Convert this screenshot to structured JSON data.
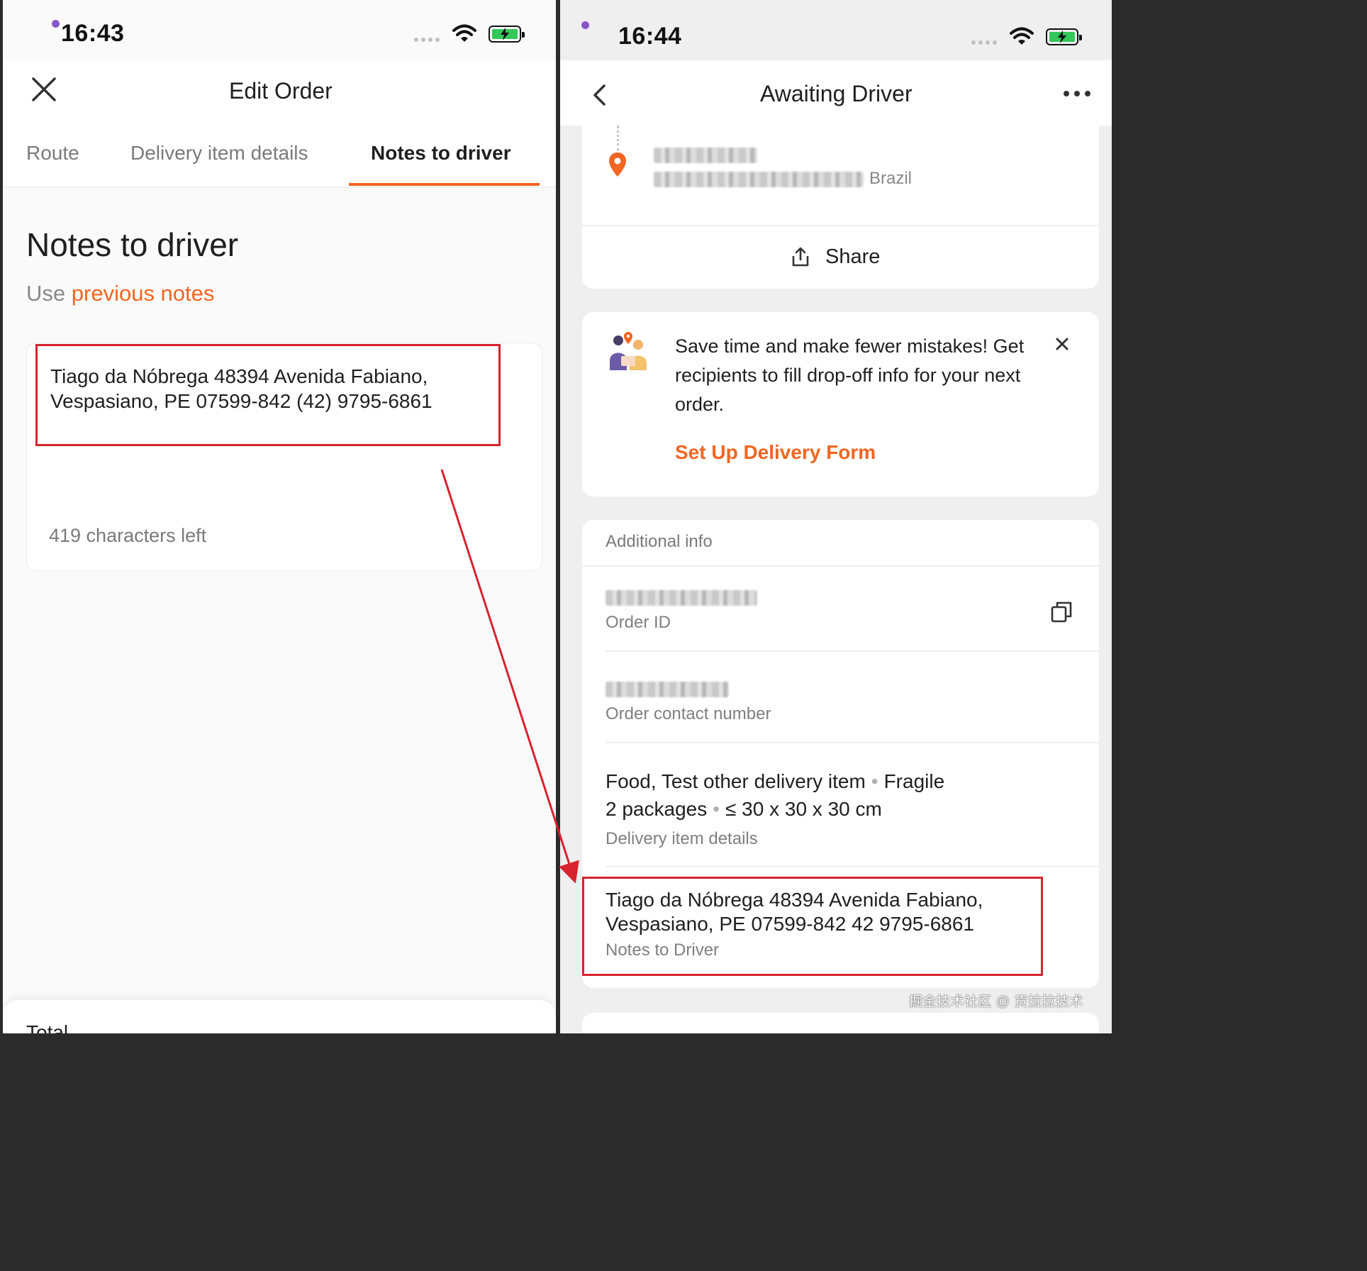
{
  "left": {
    "status": {
      "time": "16:43"
    },
    "header": {
      "title": "Edit Order"
    },
    "tabs": [
      {
        "label": "Route"
      },
      {
        "label": "Delivery item details"
      },
      {
        "label": "Notes to driver",
        "active": true
      }
    ],
    "section_title": "Notes to driver",
    "use_prefix": "Use",
    "use_link": "previous notes",
    "notes": {
      "text": "Tiago da Nóbrega  48394 Avenida Fabiano, Vespasiano, PE 07599-842  (42) 9795-6861",
      "chars_left": "419 characters left"
    },
    "bottom": {
      "total_label": "Total"
    }
  },
  "right": {
    "status": {
      "time": "16:44"
    },
    "header": {
      "title": "Awaiting Driver"
    },
    "route": {
      "country": "Brazil",
      "share_label": "Share"
    },
    "promo": {
      "text": "Save time and make fewer mistakes! Get recipients to fill drop-off info for your next order.",
      "link": "Set Up Delivery Form"
    },
    "info": {
      "header": "Additional info",
      "order_id_label": "Order ID",
      "contact_label": "Order contact number",
      "item_types": "Food, Test other delivery item",
      "item_fragile": "Fragile",
      "item_packages": "2 packages",
      "item_size": "≤ 30 x 30 x 30 cm",
      "item_details_label": "Delivery item details",
      "notes_text": "Tiago da Nóbrega  48394 Avenida Fabiano, Vespasiano, PE 07599-842  42 9795-6861",
      "notes_label": "Notes to Driver"
    }
  },
  "watermark": "掘金技术社区 @ 货拉拉技术",
  "colors": {
    "accent": "#f16622",
    "highlight": "#d6232f",
    "status_dot": "#8a55c9"
  }
}
